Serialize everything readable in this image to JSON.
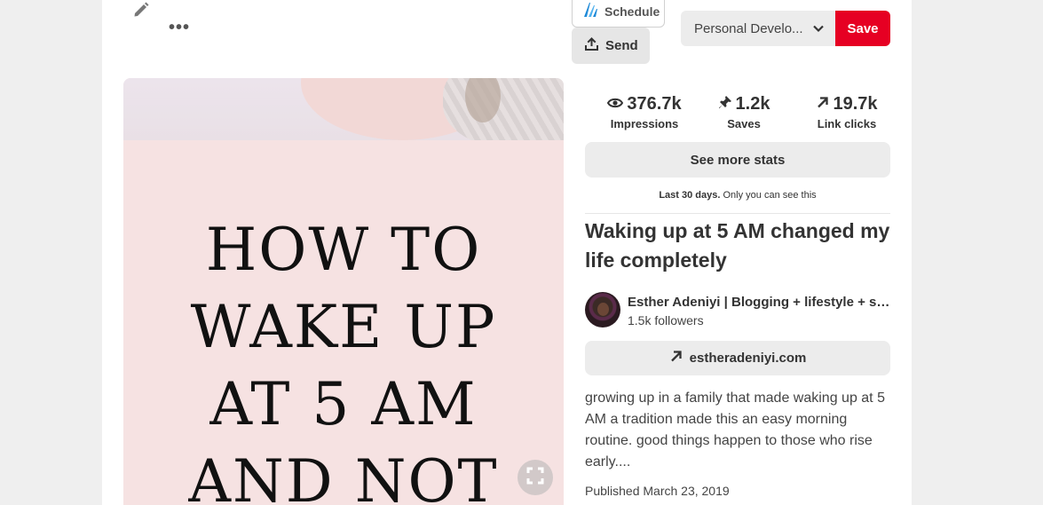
{
  "toolbar": {
    "edit_icon": "pencil-icon",
    "more_icon": "ellipsis-icon",
    "schedule_label": "Schedule",
    "send_label": "Send",
    "board_name": "Personal Develo...",
    "save_label": "Save",
    "save_color": "#e60023"
  },
  "pin_image": {
    "title_text": "HOW TO\nWAKE UP\nAT 5 AM\nAND NOT",
    "background_color": "#f6e2e2"
  },
  "stats": {
    "impressions_value": "376.7k",
    "impressions_label": "Impressions",
    "saves_value": "1.2k",
    "saves_label": "Saves",
    "clicks_value": "19.7k",
    "clicks_label": "Link clicks",
    "see_more_label": "See more stats",
    "period_bold": "Last 30 days.",
    "period_note": "Only you can see this"
  },
  "pin": {
    "title": "Waking up at 5 AM changed my life completely",
    "author_name": "Esther Adeniyi | Blogging + lifestyle + self-care + faith",
    "followers": "1.5k followers",
    "link_text": "estheradeniyi.com",
    "description": "growing up in a family that made waking up at 5 AM a tradition made this an easy morning routine. good things happen to those who rise early....",
    "published": "Published March 23, 2019"
  }
}
